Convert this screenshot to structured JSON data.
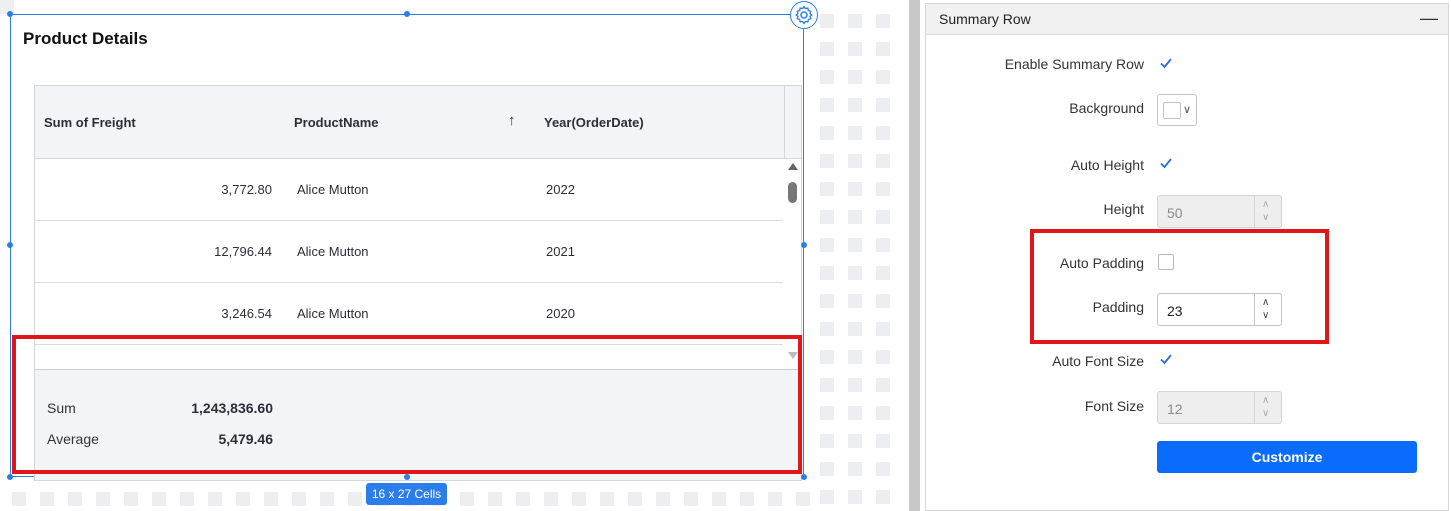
{
  "widget": {
    "title": "Product Details",
    "cells_badge": "16 x 27 Cells",
    "columns": [
      "Sum of Freight",
      "ProductName",
      "Year(OrderDate)"
    ],
    "rows": [
      {
        "freight": "3,772.80",
        "product": "Alice Mutton",
        "year": "2022"
      },
      {
        "freight": "12,796.44",
        "product": "Alice Mutton",
        "year": "2021"
      },
      {
        "freight": "3,246.54",
        "product": "Alice Mutton",
        "year": "2020"
      }
    ],
    "summary": [
      {
        "label": "Sum",
        "value": "1,243,836.60"
      },
      {
        "label": "Average",
        "value": "5,479.46"
      }
    ]
  },
  "panel": {
    "title": "Summary Row",
    "enable_summary_row": {
      "label": "Enable Summary Row",
      "checked": true
    },
    "background": {
      "label": "Background",
      "color": "#ffffff"
    },
    "auto_height": {
      "label": "Auto Height",
      "checked": true
    },
    "height": {
      "label": "Height",
      "value": "50"
    },
    "auto_padding": {
      "label": "Auto Padding",
      "checked": false
    },
    "padding": {
      "label": "Padding",
      "value": "23"
    },
    "auto_font_size": {
      "label": "Auto Font Size",
      "checked": true
    },
    "font_size": {
      "label": "Font Size",
      "value": "12"
    },
    "customize_label": "Customize"
  },
  "colors": {
    "accent": "#2b7de9",
    "button": "#0a6cff",
    "highlight": "#e0161b"
  }
}
